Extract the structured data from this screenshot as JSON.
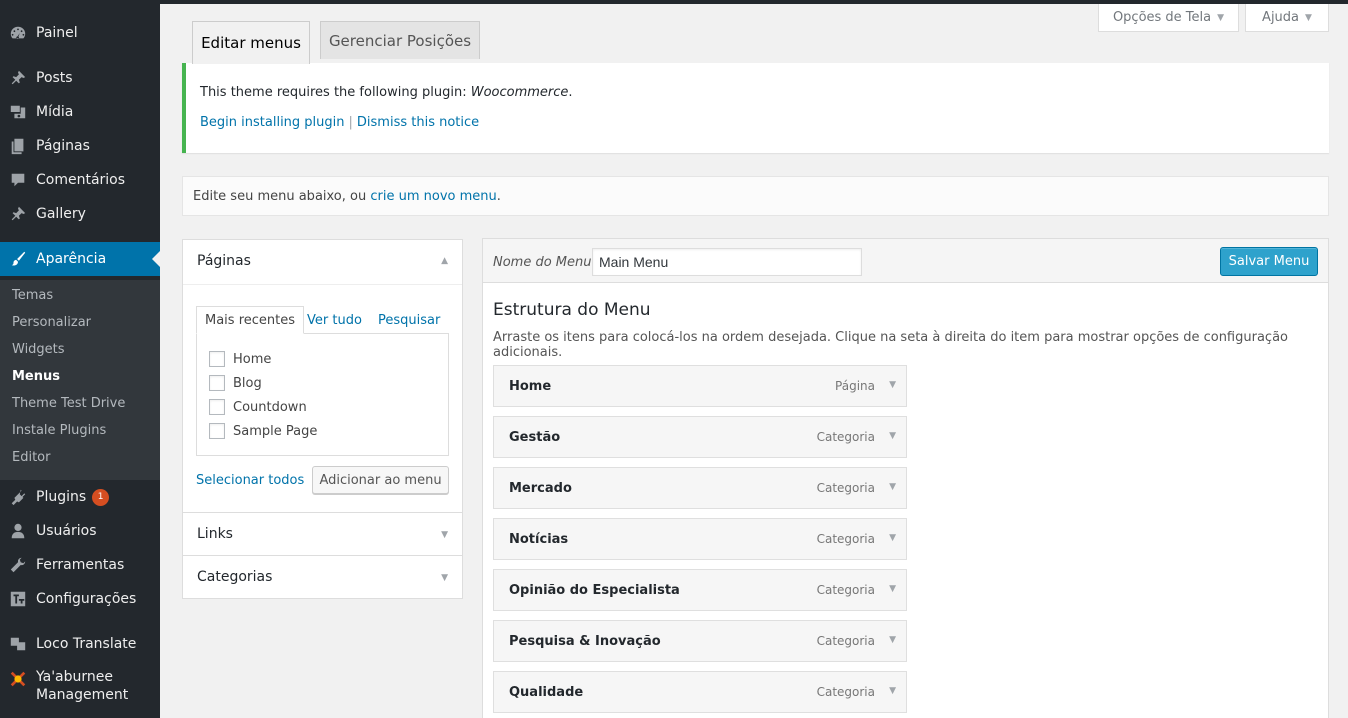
{
  "sidebar": {
    "items": [
      {
        "label": "Painel",
        "icon": "dashboard-icon"
      },
      {
        "label": "Posts",
        "icon": "pin-icon"
      },
      {
        "label": "Mídia",
        "icon": "media-icon"
      },
      {
        "label": "Páginas",
        "icon": "pages-icon"
      },
      {
        "label": "Comentários",
        "icon": "comments-icon"
      },
      {
        "label": "Gallery",
        "icon": "pin-icon"
      },
      {
        "label": "Aparência",
        "icon": "brush-icon"
      },
      {
        "label": "Plugins",
        "icon": "plug-icon",
        "badge": "1"
      },
      {
        "label": "Usuários",
        "icon": "user-icon"
      },
      {
        "label": "Ferramentas",
        "icon": "wrench-icon"
      },
      {
        "label": "Configurações",
        "icon": "settings-icon"
      },
      {
        "label": "Loco Translate",
        "icon": "translate-icon"
      },
      {
        "label": "Ya'aburnee",
        "label2": "Management",
        "icon": "plugin-logo-icon"
      }
    ],
    "submenu": [
      "Temas",
      "Personalizar",
      "Widgets",
      "Menus",
      "Theme Test Drive",
      "Instale Plugins",
      "Editor"
    ],
    "active_color": "#0073aa"
  },
  "screen_options": {
    "options_label": "Opções de Tela",
    "help_label": "Ajuda"
  },
  "tabs": {
    "edit": "Editar menus",
    "manage": "Gerenciar Posições"
  },
  "notice": {
    "text": "This theme requires the following plugin: ",
    "plugin": "Woocommerce",
    "period": ".",
    "install_link": "Begin installing plugin",
    "separator": "|",
    "dismiss_link": "Dismiss this notice"
  },
  "manage_bar": {
    "prefix": "Edite seu menu abaixo, ou ",
    "link": "crie um novo menu",
    "suffix": "."
  },
  "left_panel": {
    "pages_title": "Páginas",
    "tabs": [
      "Mais recentes",
      "Ver tudo",
      "Pesquisar"
    ],
    "pages": [
      "Home",
      "Blog",
      "Countdown",
      "Sample Page"
    ],
    "select_all": "Selecionar todos",
    "add_button": "Adicionar ao menu",
    "links_title": "Links",
    "categories_title": "Categorias"
  },
  "menu": {
    "name_label": "Nome do Menu",
    "name_value": "Main Menu",
    "save_button": "Salvar Menu",
    "structure_title": "Estrutura do Menu",
    "structure_desc": "Arraste os itens para colocá-los na ordem desejada. Clique na seta à direita do item para mostrar opções de configuração adicionais.",
    "items": [
      {
        "title": "Home",
        "type": "Página"
      },
      {
        "title": "Gestão",
        "type": "Categoria"
      },
      {
        "title": "Mercado",
        "type": "Categoria"
      },
      {
        "title": "Notícias",
        "type": "Categoria"
      },
      {
        "title": "Opinião do Especialista",
        "type": "Categoria"
      },
      {
        "title": "Pesquisa & Inovação",
        "type": "Categoria"
      },
      {
        "title": "Qualidade",
        "type": "Categoria"
      }
    ]
  }
}
